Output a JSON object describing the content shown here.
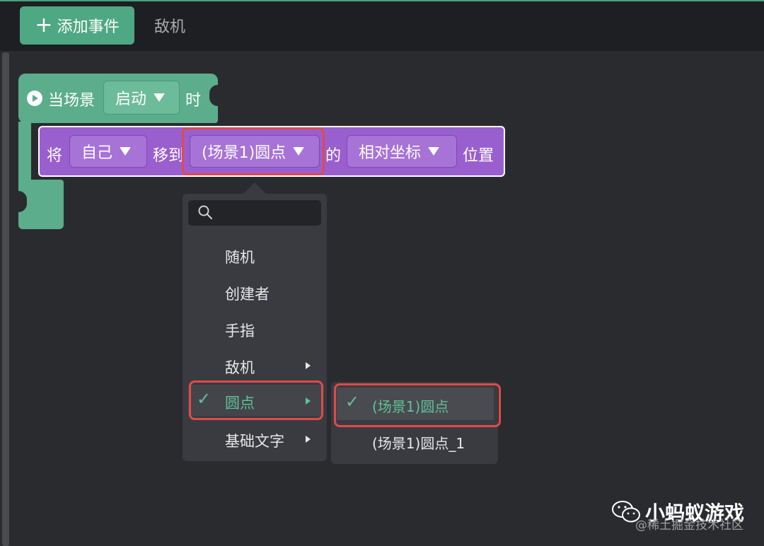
{
  "toolbar": {
    "add_event_label": "添加事件",
    "add_icon": "plus-icon",
    "enemy_tab": "敌机"
  },
  "event_block": {
    "prefix": "当场景",
    "trigger_value": "启动",
    "suffix": "时",
    "icon": "play-icon",
    "color": "#5cad8b"
  },
  "action_block": {
    "word_1": "将",
    "subject_value": "自己",
    "word_2": "移到",
    "target_value": "(场景1)圆点",
    "word_3": "的",
    "coord_value": "相对坐标",
    "word_4": "位置",
    "color": "#9a5fcf"
  },
  "dropdown_menu": {
    "search_placeholder": "",
    "items": [
      {
        "label": "随机",
        "has_submenu": false,
        "selected": false
      },
      {
        "label": "创建者",
        "has_submenu": false,
        "selected": false
      },
      {
        "label": "手指",
        "has_submenu": false,
        "selected": false
      },
      {
        "label": "敌机",
        "has_submenu": true,
        "selected": false
      },
      {
        "label": "圆点",
        "has_submenu": true,
        "selected": true
      },
      {
        "label": "基础文字",
        "has_submenu": true,
        "selected": false
      }
    ]
  },
  "submenu": {
    "items": [
      {
        "label": "(场景1)圆点",
        "selected": true
      },
      {
        "label": "(场景1)圆点_1",
        "selected": false
      }
    ]
  },
  "watermark": {
    "title": "小蚂蚁游戏",
    "subtitle": "@稀土掘金技术社区",
    "icon": "wechat-icon"
  },
  "highlight_color": "#e04a4a",
  "accent_color": "#5fc296"
}
